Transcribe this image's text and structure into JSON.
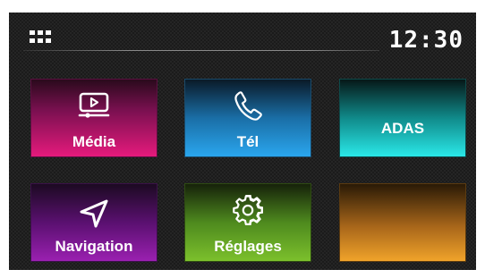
{
  "status_bar": {
    "apps_icon": "grid-icon",
    "time": "12:30"
  },
  "tiles": [
    {
      "label": "Média",
      "icon": "media-play-icon",
      "color": "#e51a7c"
    },
    {
      "label": "Tél",
      "icon": "phone-icon",
      "color": "#2aa6ee"
    },
    {
      "label": "ADAS",
      "icon": "",
      "color": "#2ae8e8"
    },
    {
      "label": "Navigation",
      "icon": "navigation-arrow-icon",
      "color": "#9a20b0"
    },
    {
      "label": "Réglages",
      "icon": "gear-icon",
      "color": "#7cc02c"
    },
    {
      "label": "",
      "icon": "",
      "color": "#f0a32a"
    }
  ]
}
